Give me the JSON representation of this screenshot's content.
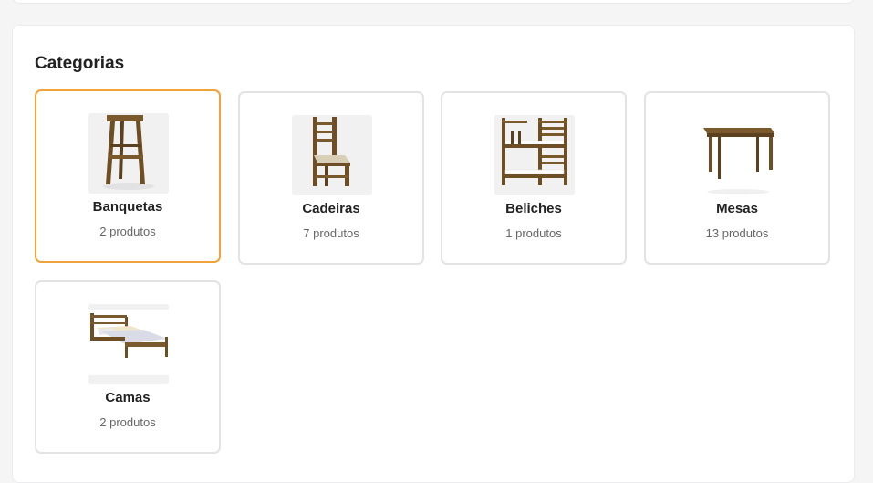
{
  "section": {
    "title": "Categorias"
  },
  "categories": [
    {
      "name": "Banquetas",
      "count": "2 produtos",
      "icon": "stool-image",
      "selected": true
    },
    {
      "name": "Cadeiras",
      "count": "7 produtos",
      "icon": "chair-image",
      "selected": false
    },
    {
      "name": "Beliches",
      "count": "1 produtos",
      "icon": "bunk-bed-image",
      "selected": false
    },
    {
      "name": "Mesas",
      "count": "13 produtos",
      "icon": "table-image",
      "selected": false
    },
    {
      "name": "Camas",
      "count": "2 produtos",
      "icon": "bed-image",
      "selected": false
    }
  ],
  "colors": {
    "selected_border": "#f0a33a",
    "card_border": "#e3e3e6",
    "wood": "#7a5a2c"
  }
}
